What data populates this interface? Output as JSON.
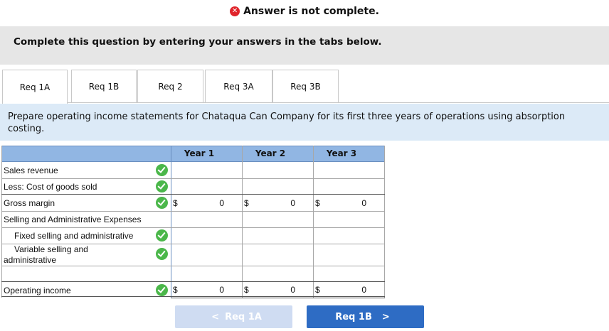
{
  "banner": {
    "icon": "x-circle-icon",
    "text": "Answer is not complete.",
    "color": "#e0242b"
  },
  "instruction": {
    "text": "Complete this question by entering your answers in the tabs below."
  },
  "tabs": [
    {
      "label": "Req 1A",
      "active": true
    },
    {
      "label": "Req 1B",
      "active": false
    },
    {
      "label": "Req 2",
      "active": false
    },
    {
      "label": "Req 3A",
      "active": false
    },
    {
      "label": "Req 3B",
      "active": false
    }
  ],
  "prompt": {
    "text": "Prepare operating income statements for Chataqua Can Company for its first three years of operations using absorption costing."
  },
  "table": {
    "columns": [
      "Year 1",
      "Year 2",
      "Year 3"
    ],
    "rows": [
      {
        "label": "Sales revenue",
        "check": true
      },
      {
        "label": "Less: Cost of goods sold",
        "check": true
      },
      {
        "label": "Gross margin",
        "check": true,
        "dollar": "$",
        "values": [
          "0",
          "0",
          "0"
        ]
      },
      {
        "label": "Selling and Administrative Expenses",
        "check": false
      },
      {
        "label": "Fixed selling and administrative",
        "check": true
      },
      {
        "label_line1": "Variable selling and",
        "label_line2": "administrative",
        "check": true
      },
      {
        "label": "",
        "check": false
      },
      {
        "label": "Operating income",
        "check": true,
        "dollar": "$",
        "values": [
          "0",
          "0",
          "0"
        ]
      }
    ],
    "header_color": "#91b6e3",
    "check_color": "#4bb74a"
  },
  "nav": {
    "prev": {
      "label": "Req 1A",
      "icon": "chevron-left-icon",
      "chevron": "<"
    },
    "next": {
      "label": "Req 1B",
      "icon": "chevron-right-icon",
      "chevron": ">"
    }
  }
}
